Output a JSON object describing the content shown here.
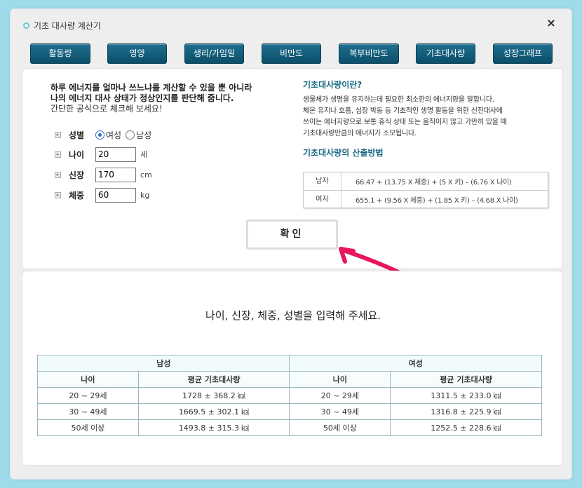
{
  "window": {
    "title": "기초 대사량 계산기",
    "close_icon": "×"
  },
  "tabs": [
    "활동량",
    "영양",
    "생리/가임일",
    "비만도",
    "복부비만도",
    "기초대사량",
    "성장그래프"
  ],
  "intro": {
    "line1": "하루 에너지를 얼마나 쓰느냐를 계산할 수 있을 뿐 아니라",
    "line2": "나의 에너지 대사 상태가 정상인지를 판단해 줍니다.",
    "line3": "간단한 공식으로 체크해 보세요!"
  },
  "form": {
    "gender_label": "성별",
    "gender_options": [
      "여성",
      "남성"
    ],
    "gender_selected": "여성",
    "age_label": "나이",
    "age_value": "20",
    "age_unit": "세",
    "height_label": "신장",
    "height_value": "170",
    "height_unit": "cm",
    "weight_label": "체중",
    "weight_value": "60",
    "weight_unit": "kg"
  },
  "info": {
    "title": "기초대사량이란?",
    "lines": [
      "생물체가 생명을 유지하는데 필요한 최소한의 에너지량을 말합니다.",
      "체온 유지나 호흡, 심장 박동 등 기초적인 생명 활동을 위한 신진대사에",
      "쓰이는 에너지량으로 보통 휴식 상태 또는 움직이지 않고 가만히 있을 때",
      "기초대사량만큼의 에너지가 소모됩니다."
    ],
    "method_title": "기초대사량의 산출방법",
    "formulas": [
      {
        "gender": "남자",
        "text": "66.47 + (13.75 X 체중) + (5 X 키) – (6.76 X 나이)"
      },
      {
        "gender": "여자",
        "text": "655.1 + (9.56 X 체중) + (1.85 X 키) – (4.68 X 나이)"
      }
    ]
  },
  "confirm_label": "확인",
  "result_message": "나이, 신장, 체중, 성별을 입력해 주세요.",
  "table": {
    "group_headers": [
      "남성",
      "여성"
    ],
    "col_headers": [
      "나이",
      "평균 기초대사량",
      "나이",
      "평균 기초대사량"
    ],
    "rows": [
      [
        "20 ~ 29세",
        "1728 ± 368.2 ㎉",
        "20 ~ 29세",
        "1311.5 ± 233.0 ㎉"
      ],
      [
        "30 ~ 49세",
        "1669.5 ± 302.1 ㎉",
        "30 ~ 49세",
        "1316.8 ± 225.9 ㎉"
      ],
      [
        "50세 이상",
        "1493.8 ± 315.3 ㎉",
        "50세 이상",
        "1252.5 ± 228.6 ㎉"
      ]
    ]
  },
  "colors": {
    "tab_bg": "#0b4e69",
    "accent_title": "#1a6b84",
    "background": "#9fdbe9",
    "arrow": "#e8175d"
  }
}
